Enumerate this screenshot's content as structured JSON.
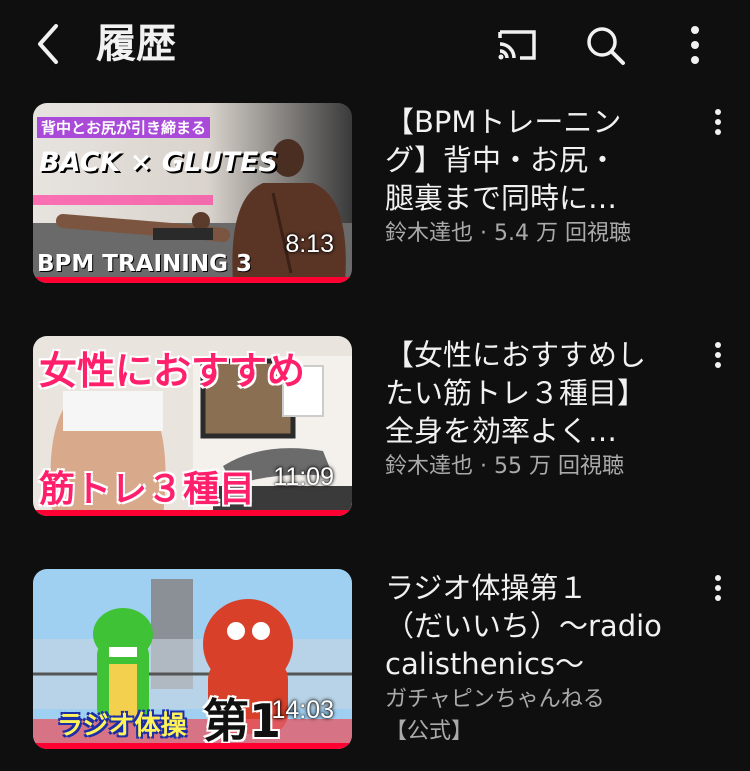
{
  "header": {
    "title": "履歴",
    "icons": [
      "back-arrow-icon",
      "cast-icon",
      "search-icon",
      "more-vert-icon"
    ]
  },
  "colors": {
    "background": "#0f0f0f",
    "progress": "#ff0033",
    "meta": "#aaaaaa"
  },
  "videos": [
    {
      "title_lines": [
        "【BPMトレーニン",
        "グ】背中・お尻・",
        "腿裏まで同時に…"
      ],
      "meta": "鈴木達也 · 5.4 万 回視聴",
      "duration": "8:13",
      "progress": 1.0,
      "thumb_text": {
        "top_banner": "背中とお尻が引き締まる",
        "headline": "BACK × GLUTES",
        "footer": "BPM TRAINING 3"
      }
    },
    {
      "title_lines": [
        "【女性におすすめし",
        "たい筋トレ３種目】",
        "全身を効率よく…"
      ],
      "meta": "鈴木達也 · 55 万 回視聴",
      "duration": "11:09",
      "progress": 1.0,
      "thumb_text": {
        "top": "女性におすすめ",
        "bottom": "筋トレ３種目"
      }
    },
    {
      "title_lines": [
        "ラジオ体操第１",
        "（だいいち）～radio",
        "calisthenics～"
      ],
      "meta_lines": [
        "ガチャピンちゃんねる",
        "【公式】"
      ],
      "duration": "14:03",
      "progress": 1.0,
      "thumb_text": {
        "left": "ラジオ体操",
        "right": "第1"
      }
    }
  ]
}
